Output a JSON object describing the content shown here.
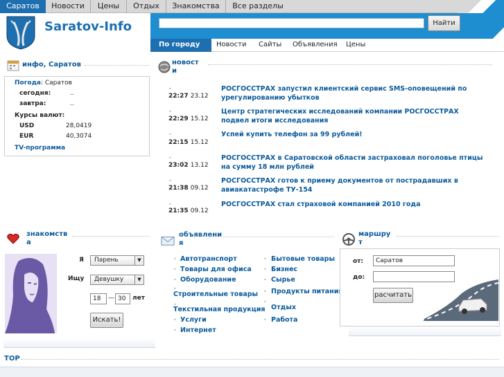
{
  "top_nav": {
    "items": [
      "Саратов",
      "Новости",
      "Цены",
      "Отдых",
      "Знакомства",
      "Все разделы"
    ]
  },
  "logo": {
    "text": "Saratov-Info"
  },
  "search": {
    "placeholder": "",
    "button": "Найти"
  },
  "city_nav": {
    "items": [
      "По городу",
      "Новости",
      "Сайты",
      "Объявления",
      "Цены"
    ]
  },
  "info": {
    "heading": "инфо, Саратов",
    "weather_label": "Погода",
    "weather_city": ": Саратов",
    "today_label": "сегодня:",
    "today_value": "..",
    "tomorrow_label": "завтра:",
    "tomorrow_value": "..",
    "rates_label": "Курсы валют:",
    "usd_label": "USD",
    "usd_value": "28,0419",
    "eur_label": "EUR",
    "eur_value": "40,3074",
    "tv_link": "TV-программа"
  },
  "news": {
    "heading_line1": "новост",
    "heading_line2": "и",
    "items": [
      {
        "time": "22:27",
        "date": "23.12",
        "title": "РОСГОССТРАХ запустил клиентский сервис SMS-оповещений по урегулированию убытков"
      },
      {
        "time": "22:29",
        "date": "15.12",
        "title": "Центр стратегических исследований компании РОСГОССТРАХ подвел итоги исследования"
      },
      {
        "time": "22:15",
        "date": "15.12",
        "title": "Успей купить телефон за 99 рублей!"
      },
      {
        "time": "23:02",
        "date": "13.12",
        "title": "РОСГОССТРАХ в Саратовской области застраховал поголовье птицы на сумму 18 млн рублей"
      },
      {
        "time": "21:38",
        "date": "09.12",
        "title": "РОСГОССТРАХ готов к приему документов от пострадавших в авиакатастрофе ТУ-154"
      },
      {
        "time": "21:35",
        "date": "09.12",
        "title": "РОСГОССТРАХ стал страховой компанией 2010 года"
      }
    ]
  },
  "dating": {
    "heading_line1": "знакомств",
    "heading_line2": "а",
    "i_label": "Я",
    "i_value": "Парень",
    "seek_label": "Ищу",
    "seek_value": "Девушку",
    "age_from": "18",
    "age_dash": "—",
    "age_to": "30",
    "age_unit": "лет",
    "search_button": "Искать!"
  },
  "ads": {
    "heading_line1": "объявлени",
    "heading_line2": "я",
    "col1": [
      "Автотранспорт",
      "Товары для офиса",
      "Оборудование",
      "Строительные товары",
      "Текстильная продукция",
      "Услуги",
      "Интернет"
    ],
    "col2": [
      "Бытовые товары",
      "Бизнес",
      "Сырье",
      "Продукты питания",
      "Отдых",
      "Работа"
    ]
  },
  "route": {
    "heading_line1": "маршру",
    "heading_line2": "т",
    "from_label": "от:",
    "from_value": "Саратов",
    "to_label": "до:",
    "to_value": "",
    "button": "расчитать"
  },
  "footer": {
    "top_link": "TOP"
  },
  "colors": {
    "accent": "#1e6fb0",
    "bright_blue": "#1e8ed0",
    "link": "#0a5a9c"
  }
}
